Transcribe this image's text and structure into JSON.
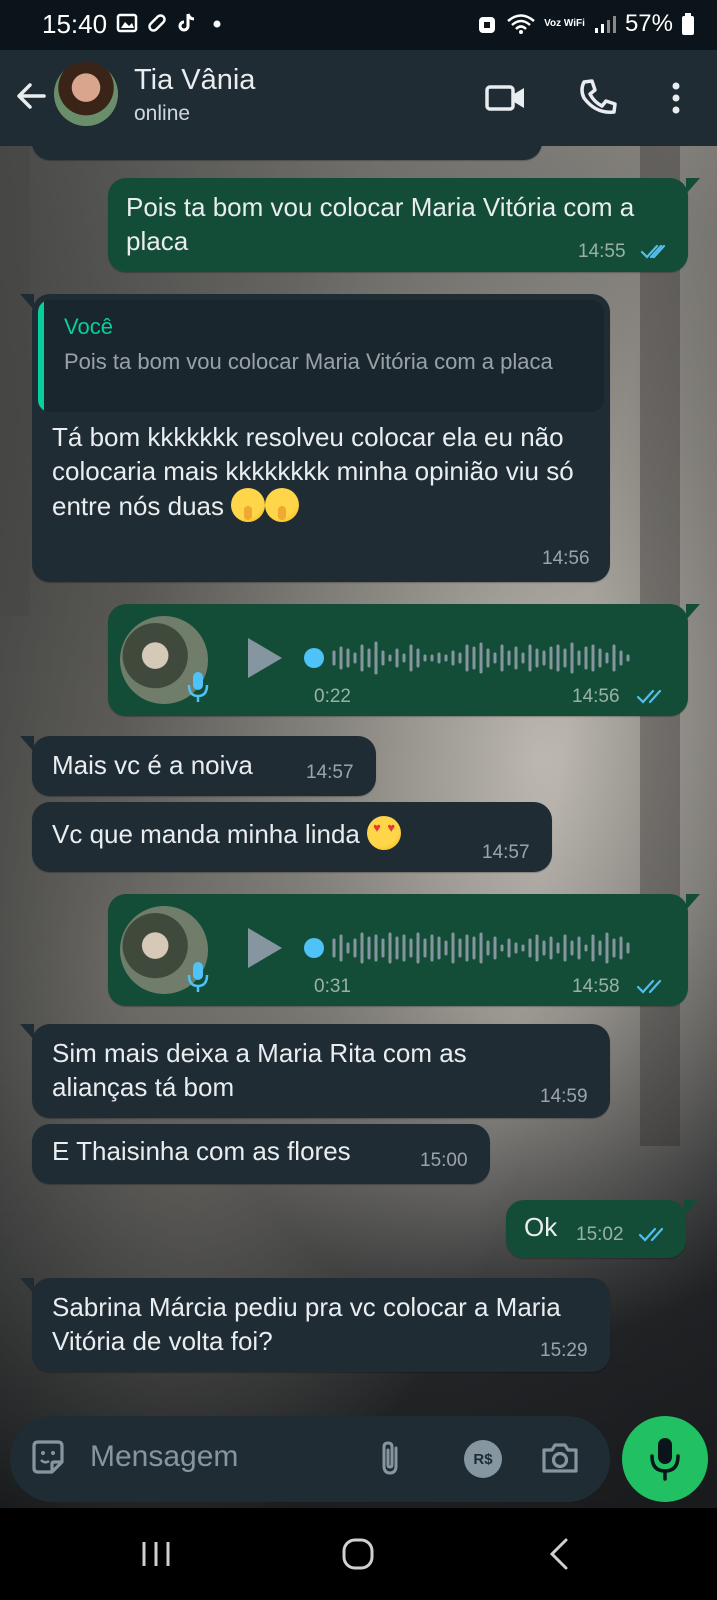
{
  "status_bar": {
    "time": "15:40",
    "battery": "57%",
    "network_label": "Voz WiFi"
  },
  "header": {
    "contact_name": "Tia Vânia",
    "status": "online"
  },
  "messages": [
    {
      "text": "Pois ta bom vou colocar Maria Vitória com a placa",
      "time": "14:55"
    },
    {
      "reply_author": "Você",
      "reply_text": "Pois ta bom vou colocar Maria Vitória com a placa",
      "text": "Tá bom kkkkkkk resolveu colocar ela eu não colocaria mais kkkkkkkk minha opinião viu só entre nós duas",
      "time": "14:56"
    },
    {
      "duration": "0:22",
      "time": "14:56"
    },
    {
      "text": "Mais vc é a noiva",
      "time": "14:57"
    },
    {
      "text": "Vc que manda minha linda",
      "time": "14:57"
    },
    {
      "duration": "0:31",
      "time": "14:58"
    },
    {
      "text": "Sim mais deixa a Maria Rita com as alianças tá bom",
      "time": "14:59"
    },
    {
      "text": "E Thaisinha com as flores",
      "time": "15:00"
    },
    {
      "text": "Ok",
      "time": "15:02"
    },
    {
      "text": "Sabrina Márcia pediu pra vc colocar a Maria Vitória de volta foi?",
      "time": "15:29"
    }
  ],
  "input": {
    "placeholder": "Mensagem",
    "currency_label": "R$"
  },
  "colors": {
    "incoming_bubble": "#1f2c34",
    "outgoing_bubble": "#144d37",
    "accent_green": "#21c063",
    "read_ticks": "#53bdeb"
  }
}
